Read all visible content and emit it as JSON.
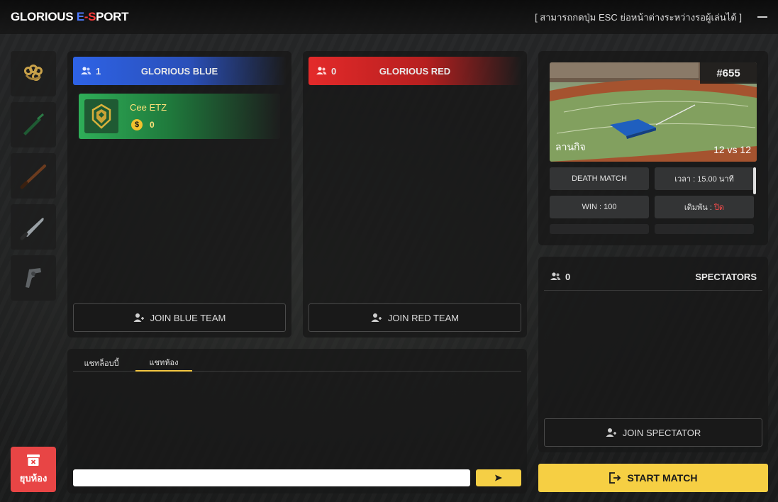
{
  "app": {
    "logo_part1": "GLORIOUS ",
    "logo_e": "E",
    "logo_dash": "-",
    "logo_s": "S",
    "logo_part2": "PORT",
    "notice": "[ สามารถกดปุ่ม ESC ย่อหน้าต่างระหว่างรอผู้เล่นได้ ]"
  },
  "sidebar": {
    "weapons": [
      "brass-knuckles-icon",
      "bottle-icon",
      "bat-icon",
      "machete-icon",
      "revolver-icon"
    ],
    "leave_label": "ยุบห้อง"
  },
  "blue_team": {
    "count": "1",
    "name": "GLORIOUS BLUE",
    "join_label": "JOIN BLUE TEAM",
    "players": [
      {
        "name": "Cee ETZ",
        "money": "0"
      }
    ]
  },
  "red_team": {
    "count": "0",
    "name": "GLORIOUS RED",
    "join_label": "JOIN RED TEAM"
  },
  "chat": {
    "tab_lobby": "แชทล็อบบี้",
    "tab_room": "แชทห้อง",
    "input_value": "",
    "send_icon": "play-icon"
  },
  "map": {
    "id": "#655",
    "name": "ลานกิจ",
    "size": "12 vs 12"
  },
  "match_info": {
    "mode": "DEATH MATCH",
    "time": "เวลา : 15.00 นาที",
    "win": "WIN : 100",
    "bet_label": "เดิมพัน :",
    "bet_value": "ปิด"
  },
  "spectators": {
    "count": "0",
    "title": "SPECTATORS",
    "join_label": "JOIN SPECTATOR"
  },
  "start": {
    "label": "START MATCH"
  },
  "colors": {
    "accent_yellow": "#f6cf43",
    "blue": "#2e63e6",
    "red": "#e42a2a",
    "green": "#2fae58",
    "leave_red": "#e84545"
  }
}
